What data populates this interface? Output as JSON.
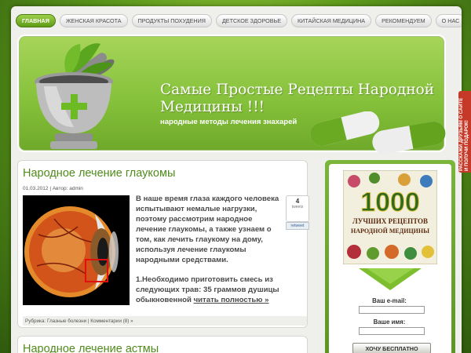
{
  "nav": {
    "items": [
      {
        "label": "Главная",
        "active": true
      },
      {
        "label": "Женская красота"
      },
      {
        "label": "Продукты похудения"
      },
      {
        "label": "Детское здоровье"
      },
      {
        "label": "Китайская медицина"
      },
      {
        "label": "Рекомендуем"
      },
      {
        "label": "О нас"
      }
    ]
  },
  "header": {
    "title": "Самые Простые Рецепты Народной Медицины !!!",
    "subtitle": "народные методы лечения знахарей"
  },
  "post": {
    "title": "Народное лечение глаукомы",
    "meta": "01.03.2012 | Автор: admin",
    "paragraph1": "В наше время глаза каждого человека испытывают немалые нагрузки, поэтому рассмотрим народное лечение глаукомы, а также узнаем о том, как лечить глаукому на дому, используя лечение глаукомы народными средствами.",
    "paragraph2": "1.Необходимо приготовить смесь из следующих трав: 35 граммов душицы обыкновенной",
    "read_more": "читать полностью »",
    "tweet_count": "4",
    "tweet_label": "tweets",
    "retweet_label": "retweet",
    "footer_prefix": "Рубрика:",
    "category": "Глазные болезни",
    "comments": "Комментарии (8) »"
  },
  "post2": {
    "title": "Народное лечение астмы"
  },
  "sidebar": {
    "book_number": "1000",
    "book_line1": "ЛУЧШИХ РЕЦЕПТОВ",
    "book_line2": "НАРОДНОЙ МЕДИЦИНЫ",
    "email_label": "Ваш e-mail:",
    "name_label": "Ваше имя:",
    "email_value": "",
    "name_value": "",
    "submit_label": "ХОЧУ БЕСПЛАТНО"
  },
  "promo_tab": {
    "line1": "РАССКАЖИ ДРУЗЬЯМ О САЙТЕ",
    "line2": "И ПОЛУЧИ ПОДАРОК!"
  },
  "colors": {
    "accent_green": "#5f9b16",
    "title_green": "#4f8b1b",
    "promo_red": "#c63827"
  }
}
